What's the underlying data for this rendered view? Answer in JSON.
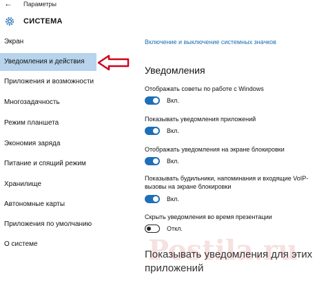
{
  "window": {
    "title": "Параметры"
  },
  "header": {
    "title": "СИСТЕМА"
  },
  "sidebar": {
    "items": [
      {
        "label": "Экран"
      },
      {
        "label": "Уведомления и действия"
      },
      {
        "label": "Приложения и возможности"
      },
      {
        "label": "Многозадачность"
      },
      {
        "label": "Режим планшета"
      },
      {
        "label": "Экономия заряда"
      },
      {
        "label": "Питание и спящий режим"
      },
      {
        "label": "Хранилище"
      },
      {
        "label": "Автономные карты"
      },
      {
        "label": "Приложения по умолчанию"
      },
      {
        "label": "О системе"
      }
    ],
    "selected_index": 1
  },
  "main": {
    "link": "Включение и выключение системных значков",
    "section_title": "Уведомления",
    "settings": [
      {
        "label": "Отображать советы по работе с Windows",
        "state": "Вкл.",
        "on": true
      },
      {
        "label": "Показывать уведомления приложений",
        "state": "Вкл.",
        "on": true
      },
      {
        "label": "Отображать уведомления на экране блокировки",
        "state": "Вкл.",
        "on": true
      },
      {
        "label": "Показывать будильники, напоминания и входящие VoIP-вызовы на экране блокировки",
        "state": "Вкл.",
        "on": true
      },
      {
        "label": "Скрыть уведомления во время презентации",
        "state": "Откл.",
        "on": false
      }
    ],
    "next_section": "Показывать уведомления для этих приложений"
  },
  "watermark": "Postila.ru",
  "colors": {
    "accent": "#1e6fb8",
    "selected_bg": "#b7d4ec",
    "arrow": "#d0021b"
  }
}
